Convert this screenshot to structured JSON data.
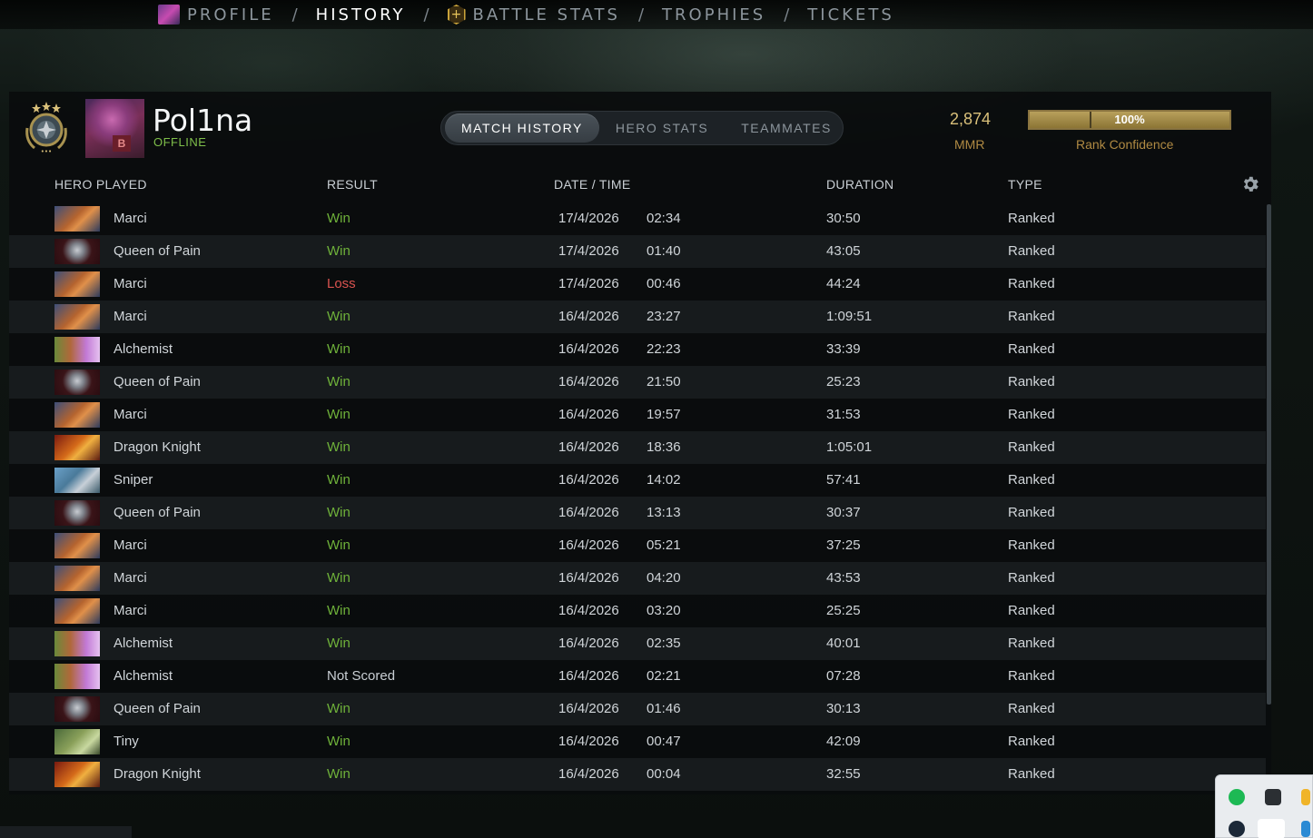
{
  "nav": {
    "items": [
      {
        "label": "PROFILE",
        "icon": "profile-icon",
        "active": false
      },
      {
        "label": "HISTORY",
        "icon": "",
        "active": true
      },
      {
        "label": "BATTLE STATS",
        "icon": "battle-pass-icon",
        "active": false
      },
      {
        "label": "TROPHIES",
        "icon": "",
        "active": false
      },
      {
        "label": "TICKETS",
        "icon": "",
        "active": false
      }
    ],
    "separator": "/"
  },
  "player": {
    "name": "Pol1na",
    "status": "OFFLINE",
    "rank_medal_icon": "rank-medal-icon",
    "avatar_badge": "B"
  },
  "tabs": [
    {
      "label": "MATCH HISTORY",
      "active": true
    },
    {
      "label": "HERO STATS",
      "active": false
    },
    {
      "label": "TEAMMATES",
      "active": false
    }
  ],
  "mmr": {
    "value": "2,874",
    "label": "MMR"
  },
  "rank_confidence": {
    "value": "100%",
    "fraction": 1.0,
    "label": "Rank Confidence"
  },
  "columns": {
    "hero": "HERO PLAYED",
    "result": "RESULT",
    "datetime": "DATE / TIME",
    "duration": "DURATION",
    "type": "TYPE"
  },
  "colors": {
    "win": "#6fb23a",
    "loss": "#d9534f",
    "gold": "#d9c07a",
    "accent_bar": "#b8a05c"
  },
  "matches": [
    {
      "hero": "Marci",
      "result": "Win",
      "date": "17/4/2026",
      "time": "02:34",
      "duration": "30:50",
      "type": "Ranked"
    },
    {
      "hero": "Queen of Pain",
      "result": "Win",
      "date": "17/4/2026",
      "time": "01:40",
      "duration": "43:05",
      "type": "Ranked"
    },
    {
      "hero": "Marci",
      "result": "Loss",
      "date": "17/4/2026",
      "time": "00:46",
      "duration": "44:24",
      "type": "Ranked"
    },
    {
      "hero": "Marci",
      "result": "Win",
      "date": "16/4/2026",
      "time": "23:27",
      "duration": "1:09:51",
      "type": "Ranked"
    },
    {
      "hero": "Alchemist",
      "result": "Win",
      "date": "16/4/2026",
      "time": "22:23",
      "duration": "33:39",
      "type": "Ranked"
    },
    {
      "hero": "Queen of Pain",
      "result": "Win",
      "date": "16/4/2026",
      "time": "21:50",
      "duration": "25:23",
      "type": "Ranked"
    },
    {
      "hero": "Marci",
      "result": "Win",
      "date": "16/4/2026",
      "time": "19:57",
      "duration": "31:53",
      "type": "Ranked"
    },
    {
      "hero": "Dragon Knight",
      "result": "Win",
      "date": "16/4/2026",
      "time": "18:36",
      "duration": "1:05:01",
      "type": "Ranked"
    },
    {
      "hero": "Sniper",
      "result": "Win",
      "date": "16/4/2026",
      "time": "14:02",
      "duration": "57:41",
      "type": "Ranked"
    },
    {
      "hero": "Queen of Pain",
      "result": "Win",
      "date": "16/4/2026",
      "time": "13:13",
      "duration": "30:37",
      "type": "Ranked"
    },
    {
      "hero": "Marci",
      "result": "Win",
      "date": "16/4/2026",
      "time": "05:21",
      "duration": "37:25",
      "type": "Ranked"
    },
    {
      "hero": "Marci",
      "result": "Win",
      "date": "16/4/2026",
      "time": "04:20",
      "duration": "43:53",
      "type": "Ranked"
    },
    {
      "hero": "Marci",
      "result": "Win",
      "date": "16/4/2026",
      "time": "03:20",
      "duration": "25:25",
      "type": "Ranked"
    },
    {
      "hero": "Alchemist",
      "result": "Win",
      "date": "16/4/2026",
      "time": "02:35",
      "duration": "40:01",
      "type": "Ranked"
    },
    {
      "hero": "Alchemist",
      "result": "Not Scored",
      "date": "16/4/2026",
      "time": "02:21",
      "duration": "07:28",
      "type": "Ranked"
    },
    {
      "hero": "Queen of Pain",
      "result": "Win",
      "date": "16/4/2026",
      "time": "01:46",
      "duration": "30:13",
      "type": "Ranked"
    },
    {
      "hero": "Tiny",
      "result": "Win",
      "date": "16/4/2026",
      "time": "00:47",
      "duration": "42:09",
      "type": "Ranked"
    },
    {
      "hero": "Dragon Knight",
      "result": "Win",
      "date": "16/4/2026",
      "time": "00:04",
      "duration": "32:55",
      "type": "Ranked"
    }
  ],
  "settings_icon": "gear-icon"
}
